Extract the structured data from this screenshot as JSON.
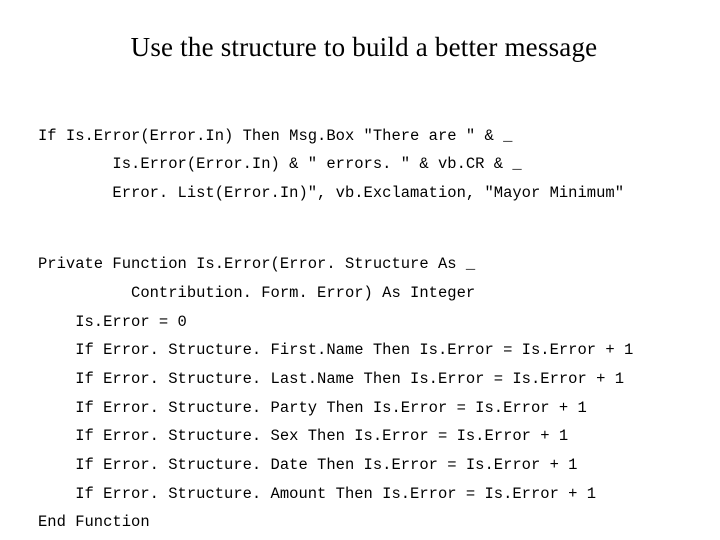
{
  "title": "Use the structure to build a better message",
  "code": {
    "line1": "If Is.Error(Error.In) Then Msg.Box \"There are \" & _",
    "line2": "        Is.Error(Error.In) & \" errors. \" & vb.CR & _",
    "line3": "        Error. List(Error.In)\", vb.Exclamation, \"Mayor Minimum\"",
    "line4": "Private Function Is.Error(Error. Structure As _",
    "line5": "          Contribution. Form. Error) As Integer",
    "line6": "    Is.Error = 0",
    "line7": "    If Error. Structure. First.Name Then Is.Error = Is.Error + 1",
    "line8": "    If Error. Structure. Last.Name Then Is.Error = Is.Error + 1",
    "line9": "    If Error. Structure. Party Then Is.Error = Is.Error + 1",
    "line10": "    If Error. Structure. Sex Then Is.Error = Is.Error + 1",
    "line11": "    If Error. Structure. Date Then Is.Error = Is.Error + 1",
    "line12": "    If Error. Structure. Amount Then Is.Error = Is.Error + 1",
    "line13": "End Function"
  }
}
